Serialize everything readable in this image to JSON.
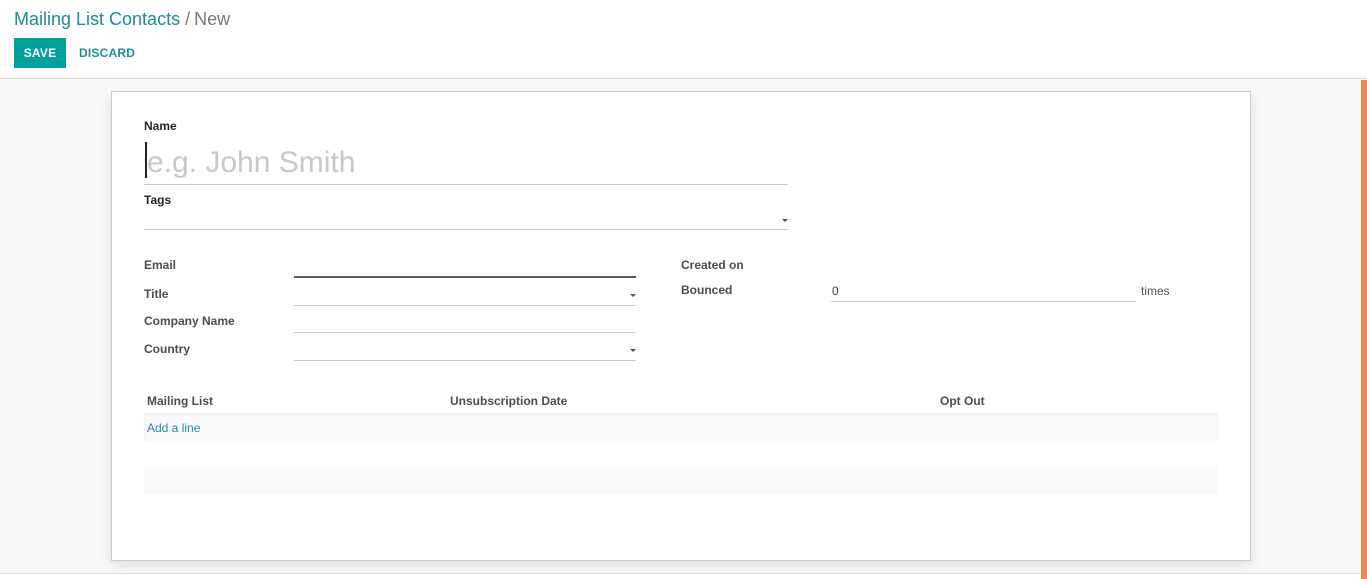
{
  "breadcrumb": {
    "parent": "Mailing List Contacts",
    "separator": "/",
    "current": "New"
  },
  "toolbar": {
    "save_label": "SAVE",
    "discard_label": "DISCARD"
  },
  "form": {
    "name": {
      "label": "Name",
      "value": "",
      "placeholder": "e.g. John Smith"
    },
    "tags": {
      "label": "Tags",
      "value": ""
    },
    "email": {
      "label": "Email",
      "value": ""
    },
    "title": {
      "label": "Title",
      "value": ""
    },
    "company_name": {
      "label": "Company Name",
      "value": ""
    },
    "country": {
      "label": "Country",
      "value": ""
    },
    "created_on": {
      "label": "Created on",
      "value": ""
    },
    "bounced": {
      "label": "Bounced",
      "value": "0",
      "suffix": "times"
    }
  },
  "subscriptions": {
    "columns": [
      "Mailing List",
      "Unsubscription Date",
      "Opt Out"
    ],
    "rows": [],
    "add_line_label": "Add a line"
  },
  "colors": {
    "primary": "#00a09d",
    "link": "#1f8c9a",
    "scroll_accent": "#e8895a"
  }
}
